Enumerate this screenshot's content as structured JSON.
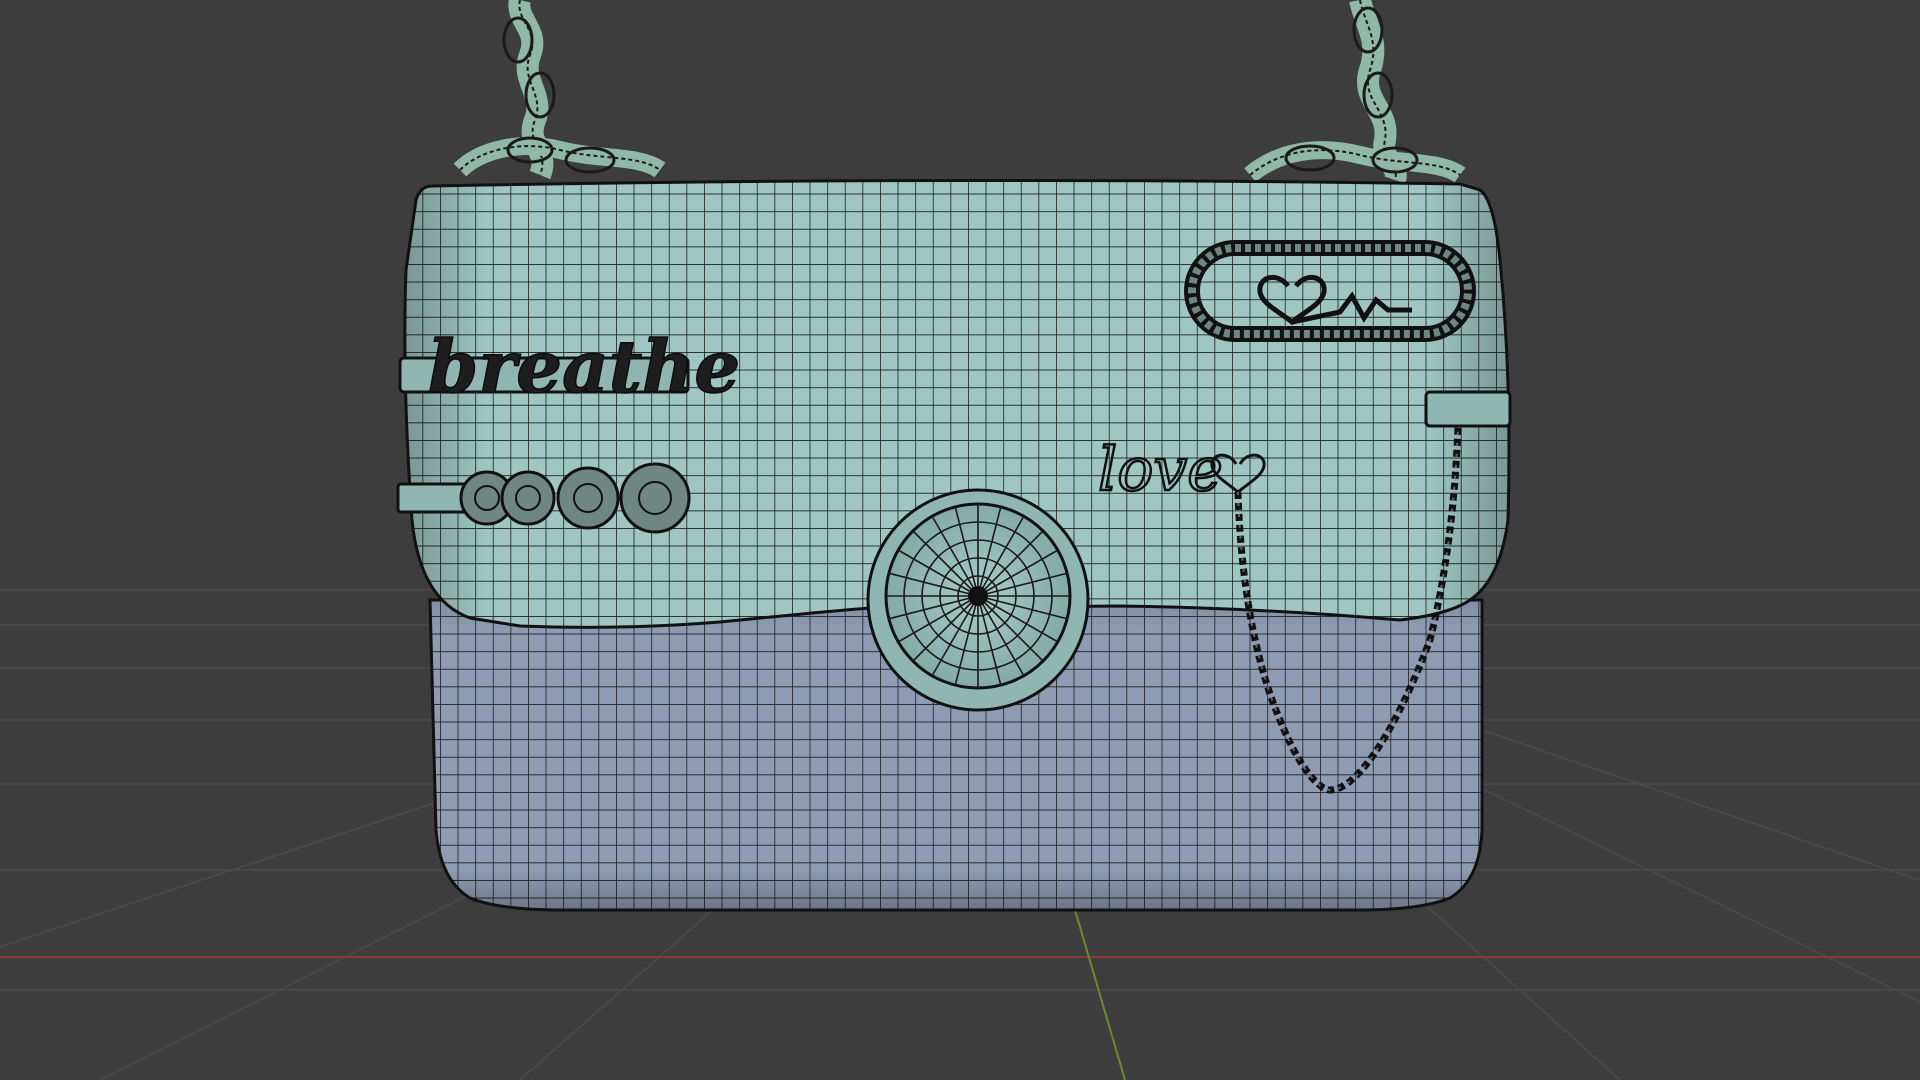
{
  "viewport": {
    "background": "#3d3d3d",
    "grid_color": "#4a4a4a",
    "x_axis_color": "#8c3a3a",
    "y_axis_color": "#6b8a2a"
  },
  "model": {
    "flap_color": "#9ec4c0",
    "body_color": "#8f9db3",
    "wire_color": "#1a1a1a",
    "chain_color": "#8fb8a8",
    "decor": {
      "script_text": "breathe",
      "handwritten_text": "love"
    }
  }
}
